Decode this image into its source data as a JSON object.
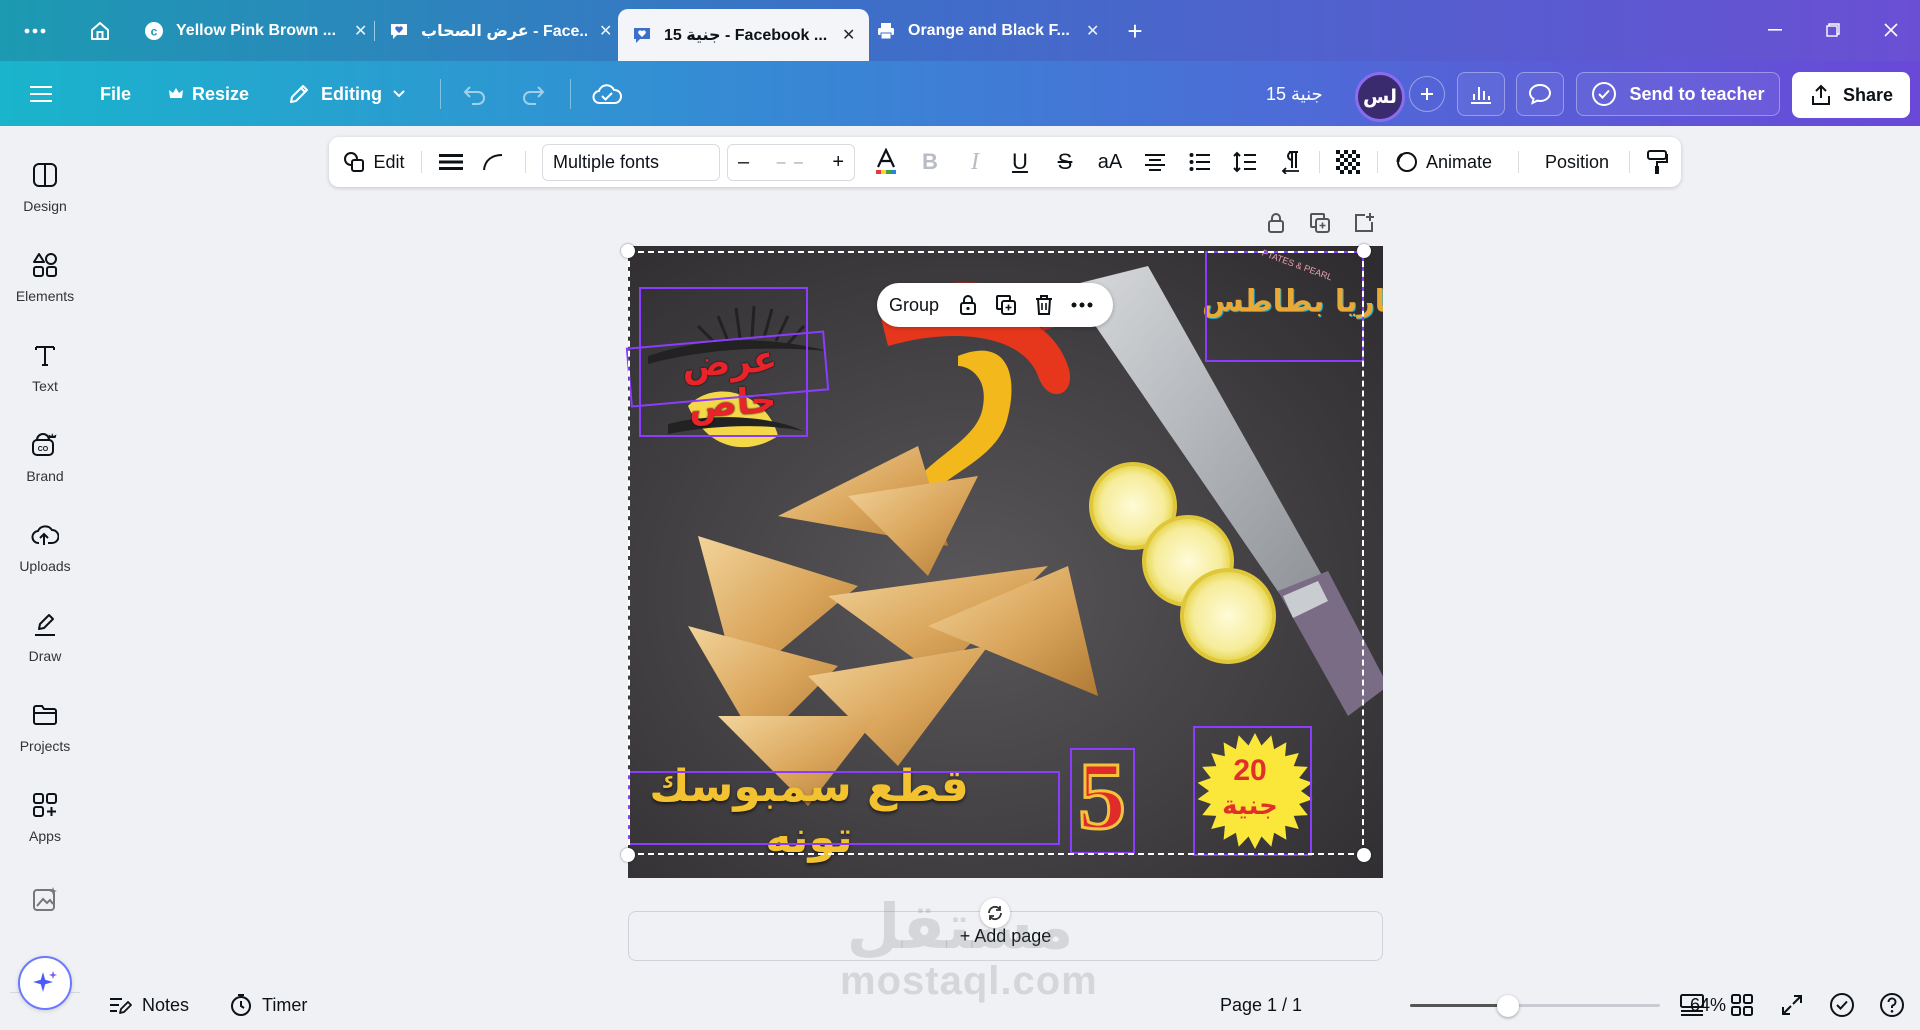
{
  "browser": {
    "tabs": [
      {
        "title": "Yellow Pink Brown ...",
        "active": false
      },
      {
        "title": "عرض الصحاب - Face...",
        "active": false
      },
      {
        "title": "15 جنية - Facebook ...",
        "active": true
      },
      {
        "title": "Orange and Black F...",
        "active": false
      }
    ],
    "new_tab": "+"
  },
  "header": {
    "file": "File",
    "resize": "Resize",
    "editing": "Editing",
    "doc_title": "15 جنية",
    "avatar": "لس",
    "send_to_teacher": "Send to teacher",
    "share": "Share"
  },
  "rail": {
    "items": [
      {
        "label": "Design",
        "icon": "design-icon"
      },
      {
        "label": "Elements",
        "icon": "elements-icon"
      },
      {
        "label": "Text",
        "icon": "text-icon"
      },
      {
        "label": "Brand",
        "icon": "brand-icon"
      },
      {
        "label": "Uploads",
        "icon": "uploads-icon"
      },
      {
        "label": "Draw",
        "icon": "draw-icon"
      },
      {
        "label": "Projects",
        "icon": "projects-icon"
      },
      {
        "label": "Apps",
        "icon": "apps-icon"
      }
    ]
  },
  "toolbar": {
    "edit": "Edit",
    "font": "Multiple fonts",
    "size_minus": "–",
    "size_value": "– –",
    "size_plus": "+",
    "case": "aA",
    "animate": "Animate",
    "position": "Position"
  },
  "canvas": {
    "group_label": "Group",
    "add_page": "+ Add page",
    "design": {
      "badge_title": "عرض خاص",
      "logo_text": "بساريا بطاطس",
      "logo_arc": "PTATES & PEARL",
      "product_text": "قطع سمبوسك تونه",
      "quantity": "5",
      "price_value": "20",
      "price_unit": "جنية"
    },
    "watermark_ar": "مستقل",
    "watermark_en": "mostaql.com"
  },
  "footer": {
    "notes": "Notes",
    "timer": "Timer",
    "page": "Page 1 / 1",
    "zoom": "64%",
    "zoom_slider_fraction": 0.39
  },
  "colors": {
    "accent": "#8b3dff",
    "header_start": "#1ab4cc",
    "header_end": "#6a48d8"
  }
}
